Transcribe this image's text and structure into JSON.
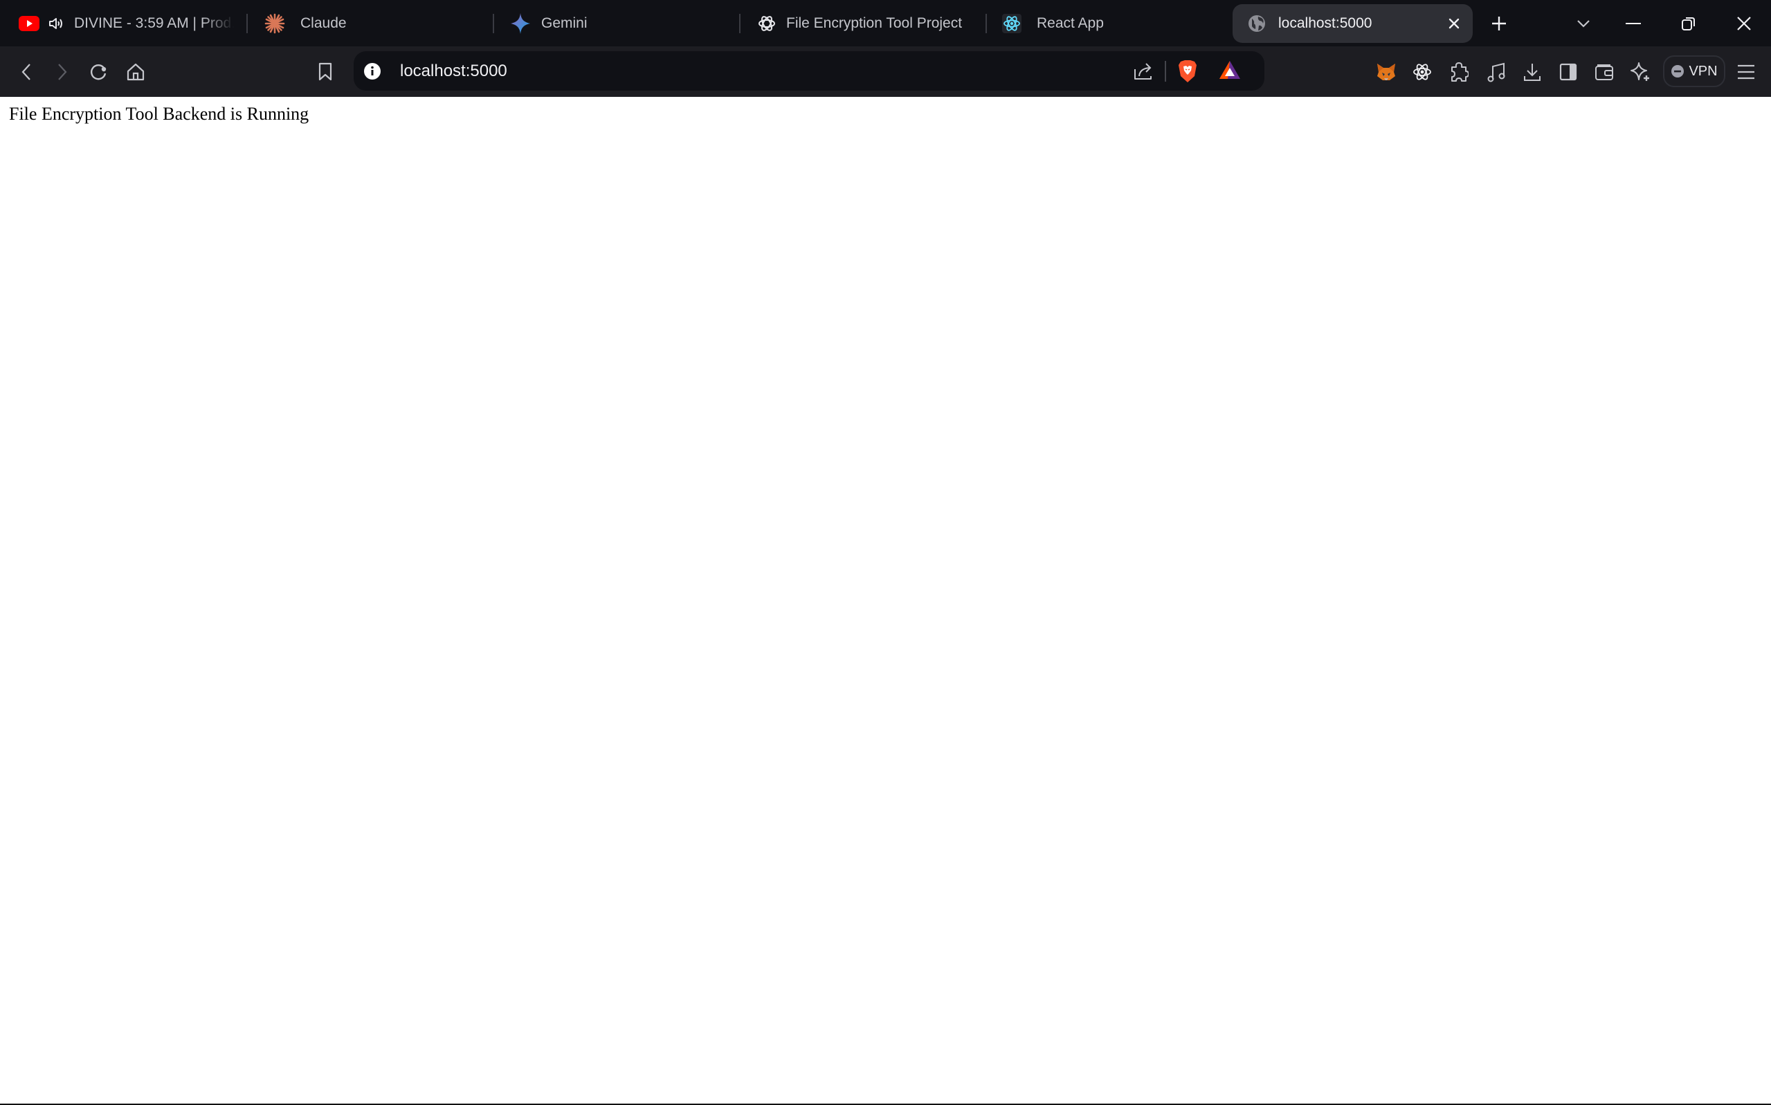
{
  "browser": {
    "tabs": [
      {
        "title": "DIVINE - 3:59 AM | Prod.",
        "icon": "youtube-icon",
        "audio": true,
        "active": false
      },
      {
        "title": "Claude",
        "icon": "claude-icon",
        "active": false
      },
      {
        "title": "Gemini",
        "icon": "gemini-icon",
        "active": false
      },
      {
        "title": "File Encryption Tool Project",
        "icon": "chatgpt-icon",
        "active": false
      },
      {
        "title": "React App",
        "icon": "react-icon",
        "active": false
      },
      {
        "title": "localhost:5000",
        "icon": "globe-icon",
        "active": true
      }
    ],
    "new_tab_label": "+",
    "address_bar": {
      "url": "localhost:5000"
    },
    "vpn_label": "VPN",
    "colors": {
      "tabbar_bg": "#101116",
      "toolbar_bg": "#1d1d22",
      "active_tab_bg": "#2e2f35",
      "brave_orange": "#fb542b",
      "youtube_red": "#ff0000"
    }
  },
  "page": {
    "body_text": "File Encryption Tool Backend is Running"
  }
}
